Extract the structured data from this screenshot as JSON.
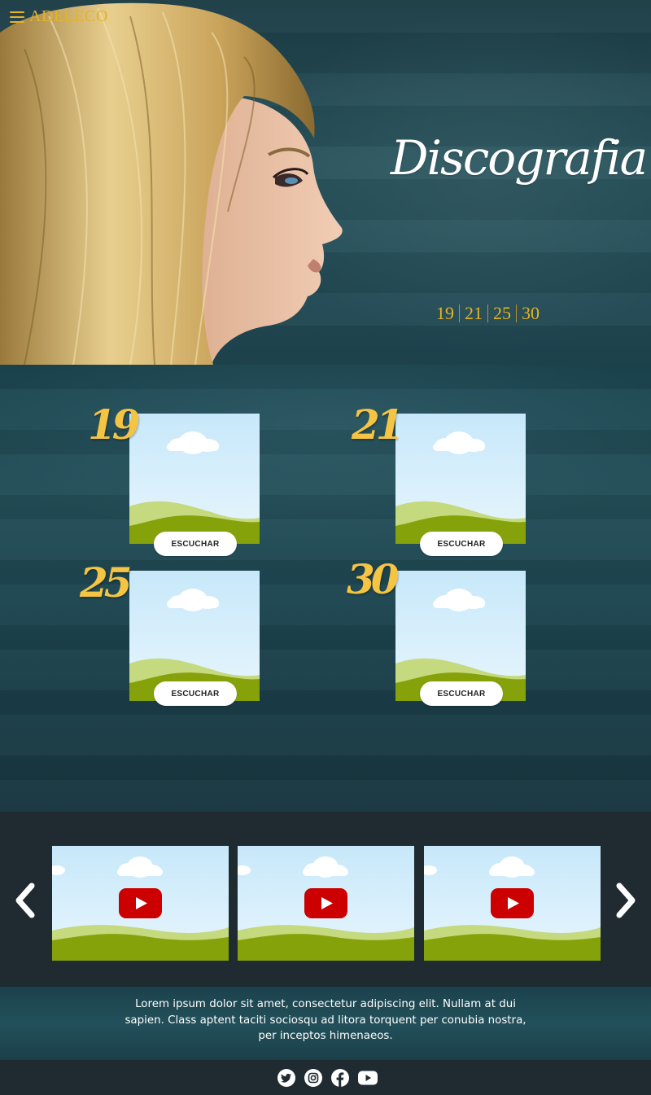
{
  "header": {
    "brand": "ADELECO",
    "menu_icon": "hamburger-menu-icon"
  },
  "hero": {
    "title": "Discografia",
    "albums_nav": [
      "19",
      "21",
      "25",
      "30"
    ]
  },
  "discography": {
    "albums": [
      {
        "year": "19",
        "button": "ESCUCHAR"
      },
      {
        "year": "21",
        "button": "ESCUCHAR"
      },
      {
        "year": "25",
        "button": "ESCUCHAR"
      },
      {
        "year": "30",
        "button": "ESCUCHAR"
      }
    ]
  },
  "videos": {
    "prev_icon": "chevron-left-icon",
    "next_icon": "chevron-right-icon",
    "items": [
      {
        "icon": "youtube-play-icon"
      },
      {
        "icon": "youtube-play-icon"
      },
      {
        "icon": "youtube-play-icon"
      }
    ]
  },
  "about": {
    "text": "Lorem ipsum dolor sit amet, consectetur adipiscing elit. Nullam at dui sapien. Class aptent taciti sociosqu ad litora torquent per conubia nostra, per inceptos himenaeos."
  },
  "footer": {
    "social": [
      "twitter-icon",
      "instagram-icon",
      "facebook-icon",
      "youtube-icon"
    ]
  },
  "colors": {
    "accent_gold": "#e7b321",
    "year_gold": "#f6c443",
    "dark_bg": "#1f2b31",
    "teal_bg": "#234e58",
    "youtube_red": "#cc0000"
  }
}
